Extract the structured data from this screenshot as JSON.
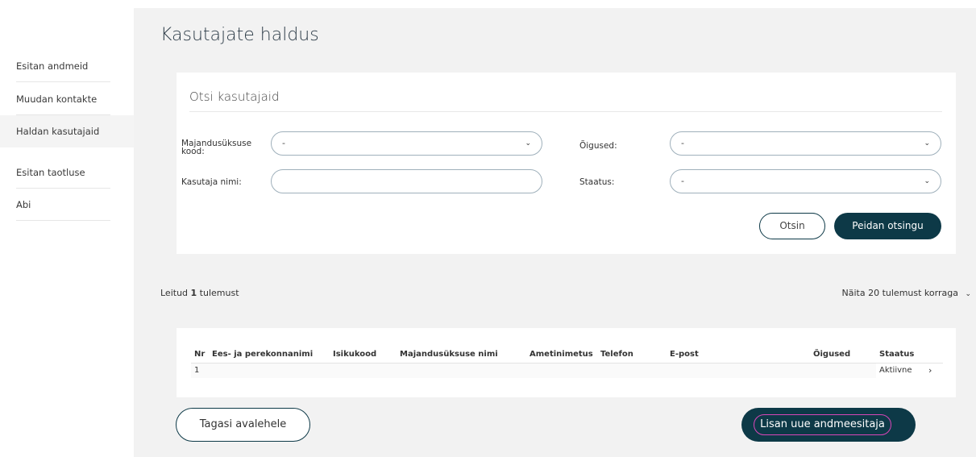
{
  "sidebar": {
    "items": [
      {
        "label": "Esitan andmeid"
      },
      {
        "label": "Muudan kontakte"
      },
      {
        "label": "Haldan kasutajaid"
      },
      {
        "label": "Esitan taotluse"
      },
      {
        "label": "Abi"
      }
    ]
  },
  "page": {
    "title": "Kasutajate haldus"
  },
  "search": {
    "title": "Otsi kasutajaid",
    "unit_code_label": "Majandusüksuse kood:",
    "unit_code_value": "-",
    "rights_label": "Õigused:",
    "rights_value": "-",
    "user_name_label": "Kasutaja nimi:",
    "user_name_value": "",
    "status_label": "Staatus:",
    "status_value": "-",
    "search_button": "Otsin",
    "save_search_button": "Peidan otsingu"
  },
  "results": {
    "found_prefix": "Leitud ",
    "found_count": "1",
    "found_suffix": " tulemust",
    "page_size_label": "Näita 20 tulemust korraga"
  },
  "table": {
    "headers": {
      "nr": "Nr",
      "name": "Ees- ja perekonnanimi",
      "id_code": "Isikukood",
      "unit_name": "Majandusüksuse nimi",
      "position": "Ametinimetus",
      "phone": "Telefon",
      "email": "E-post",
      "rights": "Õigused",
      "status": "Staatus"
    },
    "rows": [
      {
        "nr": "1",
        "name": "",
        "id_code": "",
        "unit_name": "",
        "position": "",
        "phone": "",
        "email": "",
        "rights": "",
        "status": "Aktiivne"
      }
    ]
  },
  "footer": {
    "back_button": "Tagasi avalehele",
    "add_button": "Lisan uue andmeesitaja"
  },
  "icons": {
    "chevron": "chevron-down-icon",
    "row_arrow": "chevron-right-icon"
  },
  "colors": {
    "primary": "#0d3947",
    "focus_ring": "#d946b8",
    "background": "#f2f2f2"
  }
}
